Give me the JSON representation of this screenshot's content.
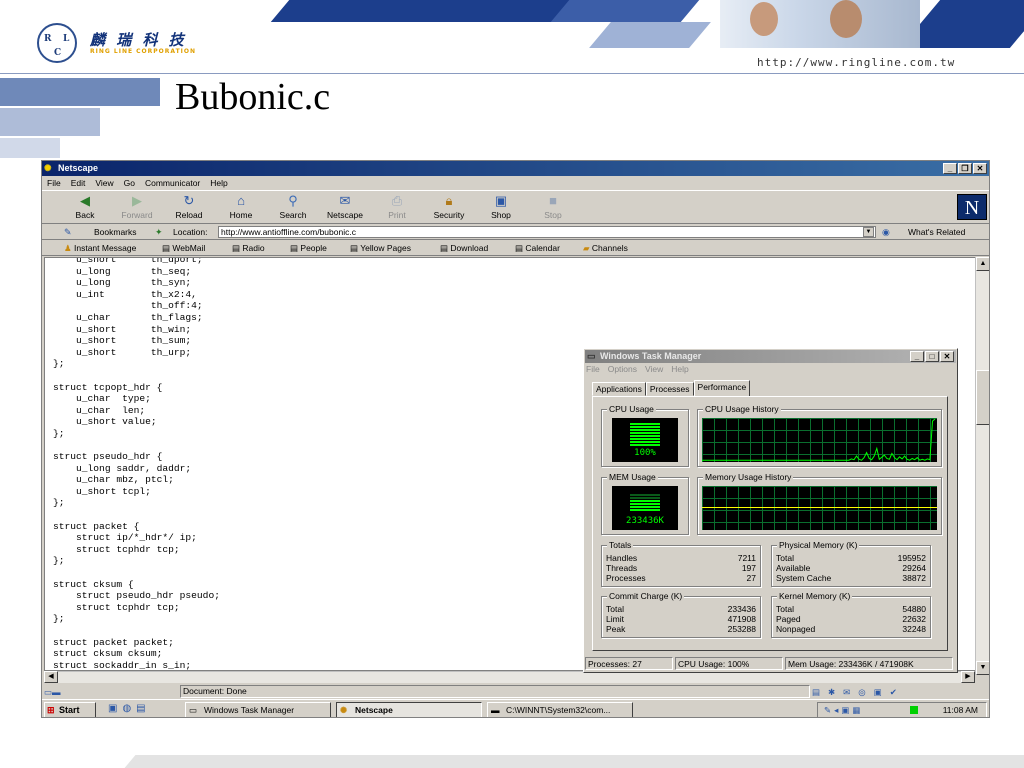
{
  "slide": {
    "title": "Bubonic.c",
    "company_zh": "麟 瑞 科 技",
    "company_en": "RING LINE CORPORATION",
    "logo_letters": [
      "R",
      "L",
      "C"
    ],
    "url": "http://www.ringline.com.tw"
  },
  "browser": {
    "title": "Netscape",
    "menu": [
      "File",
      "Edit",
      "View",
      "Go",
      "Communicator",
      "Help"
    ],
    "toolbar": [
      {
        "label": "Back",
        "icon": "back-arrow-icon",
        "enabled": true
      },
      {
        "label": "Forward",
        "icon": "forward-arrow-icon",
        "enabled": false
      },
      {
        "label": "Reload",
        "icon": "reload-icon",
        "enabled": true
      },
      {
        "label": "Home",
        "icon": "home-icon",
        "enabled": true
      },
      {
        "label": "Search",
        "icon": "search-icon",
        "enabled": true
      },
      {
        "label": "Netscape",
        "icon": "netscape-icon",
        "enabled": true
      },
      {
        "label": "Print",
        "icon": "print-icon",
        "enabled": false
      },
      {
        "label": "Security",
        "icon": "lock-icon",
        "enabled": true
      },
      {
        "label": "Shop",
        "icon": "shop-icon",
        "enabled": true
      },
      {
        "label": "Stop",
        "icon": "stop-icon",
        "enabled": false
      }
    ],
    "bookmarks_label": "Bookmarks",
    "location_label": "Location:",
    "location_value": "http://www.antioffline.com/bubonic.c",
    "whats_related": "What's Related",
    "personal_toolbar": [
      "Instant Message",
      "WebMail",
      "Radio",
      "People",
      "Yellow Pages",
      "Download",
      "Calendar",
      "Channels"
    ],
    "status": "Document: Done",
    "code_lines": [
      "    u_short      th_dport;",
      "    u_long       th_seq;",
      "    u_long       th_syn;",
      "    u_int        th_x2:4,",
      "                 th_off:4;",
      "    u_char       th_flags;",
      "    u_short      th_win;",
      "    u_short      th_sum;",
      "    u_short      th_urp;",
      "};",
      "",
      "struct tcpopt_hdr {",
      "    u_char  type;",
      "    u_char  len;",
      "    u_short value;",
      "};",
      "",
      "struct pseudo_hdr {",
      "    u_long saddr, daddr;",
      "    u_char mbz, ptcl;",
      "    u_short tcpl;",
      "};",
      "",
      "struct packet {",
      "    struct ip/*_hdr*/ ip;",
      "    struct tcphdr tcp;",
      "};",
      "",
      "struct cksum {",
      "    struct pseudo_hdr pseudo;",
      "    struct tcphdr tcp;",
      "};",
      "",
      "struct packet packet;",
      "struct cksum cksum;",
      "struct sockaddr_in s_in;"
    ]
  },
  "taskmgr": {
    "title": "Windows Task Manager",
    "menu": [
      "File",
      "Options",
      "View",
      "Help"
    ],
    "tabs": [
      "Applications",
      "Processes",
      "Performance"
    ],
    "active_tab": "Performance",
    "cpu_usage_label": "CPU Usage",
    "cpu_usage_value": "100%",
    "cpu_usage_fraction": 1.0,
    "cpu_history_label": "CPU Usage History",
    "cpu_history": [
      2,
      2,
      2,
      2,
      2,
      2,
      2,
      2,
      2,
      2,
      2,
      2,
      2,
      2,
      2,
      2,
      2,
      2,
      2,
      2,
      2,
      2,
      2,
      2,
      2,
      2,
      2,
      2,
      2,
      2,
      2,
      2,
      2,
      2,
      2,
      2,
      2,
      2,
      2,
      2,
      2,
      2,
      2,
      2,
      2,
      2,
      2,
      2,
      2,
      2,
      2,
      2,
      2,
      2,
      2,
      2,
      2,
      2,
      2,
      5,
      3,
      12,
      4,
      2,
      8,
      20,
      6,
      3,
      12,
      30,
      4,
      9,
      14,
      6,
      4,
      18,
      8,
      3,
      10,
      5,
      12,
      4,
      2,
      6,
      3,
      8,
      2,
      4,
      2,
      5,
      3,
      95,
      100
    ],
    "mem_usage_label": "MEM Usage",
    "mem_usage_value": "233436K",
    "mem_history_label": "Memory Usage History",
    "totals": {
      "label": "Totals",
      "rows": [
        {
          "k": "Handles",
          "v": "7211"
        },
        {
          "k": "Threads",
          "v": "197"
        },
        {
          "k": "Processes",
          "v": "27"
        }
      ]
    },
    "physical": {
      "label": "Physical Memory (K)",
      "rows": [
        {
          "k": "Total",
          "v": "195952"
        },
        {
          "k": "Available",
          "v": "29264"
        },
        {
          "k": "System Cache",
          "v": "38872"
        }
      ]
    },
    "commit": {
      "label": "Commit Charge (K)",
      "rows": [
        {
          "k": "Total",
          "v": "233436"
        },
        {
          "k": "Limit",
          "v": "471908"
        },
        {
          "k": "Peak",
          "v": "253288"
        }
      ]
    },
    "kernel": {
      "label": "Kernel Memory (K)",
      "rows": [
        {
          "k": "Total",
          "v": "54880"
        },
        {
          "k": "Paged",
          "v": "22632"
        },
        {
          "k": "Nonpaged",
          "v": "32248"
        }
      ]
    },
    "status": {
      "processes": "Processes: 27",
      "cpu": "CPU Usage: 100%",
      "mem": "Mem Usage: 233436K / 471908K"
    }
  },
  "taskbar": {
    "start": "Start",
    "items": [
      "Windows Task Manager",
      "Netscape",
      "C:\\WINNT\\System32\\com..."
    ],
    "active_item": "Netscape",
    "clock": "11:08 AM"
  },
  "colors": {
    "accent_blue": "#0a246a",
    "graph_green": "#00ff00",
    "grid_green": "#0a6e2e",
    "deco_blue": "#6f89b9"
  }
}
